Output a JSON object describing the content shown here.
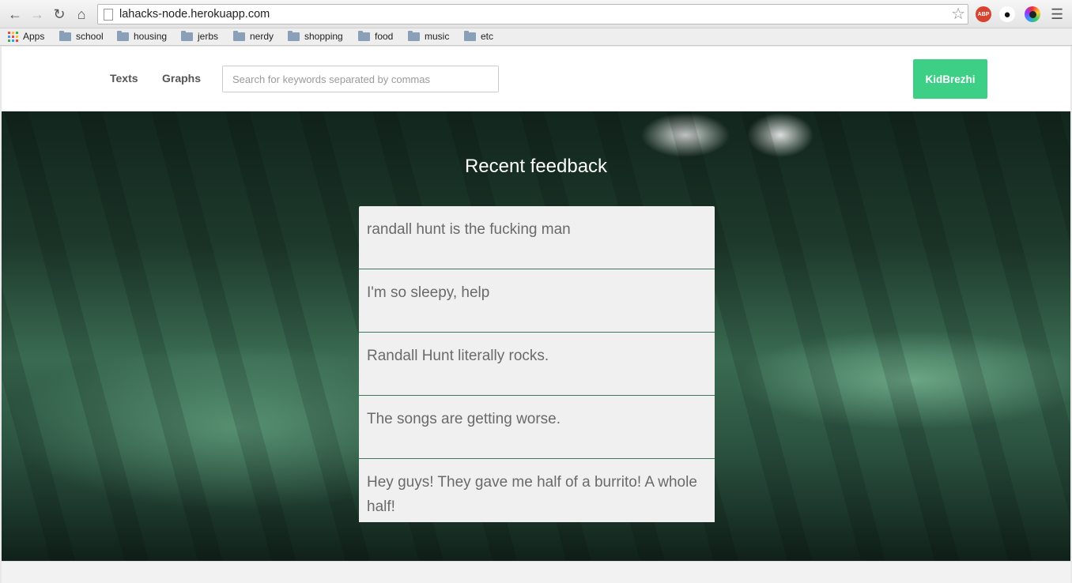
{
  "browser": {
    "url": "lahacks-node.herokuapp.com",
    "bookmarks": [
      {
        "label": "Apps"
      },
      {
        "label": "school"
      },
      {
        "label": "housing"
      },
      {
        "label": "jerbs"
      },
      {
        "label": "nerdy"
      },
      {
        "label": "shopping"
      },
      {
        "label": "food"
      },
      {
        "label": "music"
      },
      {
        "label": "etc"
      }
    ],
    "extensions": {
      "abp_label": "ABP"
    }
  },
  "nav": {
    "texts_label": "Texts",
    "graphs_label": "Graphs",
    "search_placeholder": "Search for keywords separated by commas",
    "user_label": "KidBrezhi",
    "user_color": "#3ecf87"
  },
  "hero": {
    "title": "Recent feedback",
    "feedback": [
      {
        "text": "randall hunt is the fucking man"
      },
      {
        "text": "I'm so sleepy, help"
      },
      {
        "text": "Randall Hunt literally rocks."
      },
      {
        "text": "The songs are getting worse."
      },
      {
        "text": "Hey guys! They gave me half of a burrito! A whole half!"
      }
    ]
  }
}
